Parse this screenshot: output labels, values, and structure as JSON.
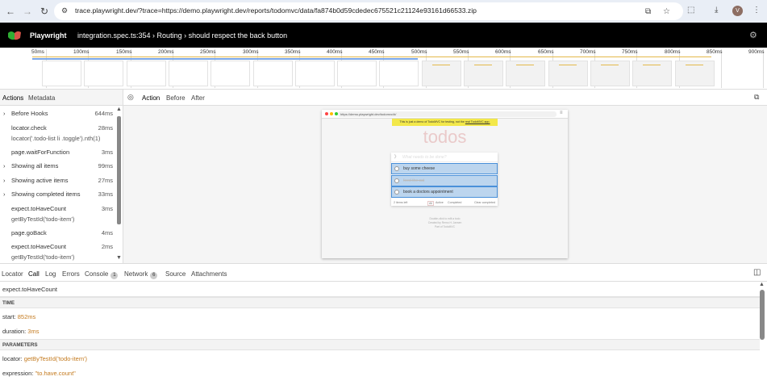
{
  "browser": {
    "url": "trace.playwright.dev/?trace=https://demo.playwright.dev/reports/todomvc/data/fa874b0d59cdedec675521c21124e93161d66533.zip",
    "profile_initial": "V"
  },
  "header": {
    "app_name": "Playwright",
    "test_path": "integration.spec.ts:354 › Routing › should respect the back button"
  },
  "timeline": {
    "ticks": [
      "50ms",
      "100ms",
      "150ms",
      "200ms",
      "250ms",
      "300ms",
      "350ms",
      "400ms",
      "450ms",
      "500ms",
      "550ms",
      "600ms",
      "650ms",
      "700ms",
      "750ms",
      "800ms",
      "850ms",
      "900ms"
    ]
  },
  "left_panel": {
    "tabs": [
      "Actions",
      "Metadata"
    ],
    "actions": [
      {
        "label": "Before Hooks",
        "duration": "644ms",
        "expandable": true
      },
      {
        "label": "locator.check",
        "sub": "locator('.todo-list li .toggle').nth(1)",
        "duration": "28ms"
      },
      {
        "label": "page.waitForFunction",
        "duration": "3ms"
      },
      {
        "label": "Showing all items",
        "duration": "99ms",
        "expandable": true
      },
      {
        "label": "Showing active items",
        "duration": "27ms",
        "expandable": true
      },
      {
        "label": "Showing completed items",
        "duration": "33ms",
        "expandable": true
      },
      {
        "label": "expect.toHaveCount",
        "sub": "getByTestId('todo-item')",
        "duration": "3ms"
      },
      {
        "label": "page.goBack",
        "duration": "4ms"
      },
      {
        "label": "expect.toHaveCount",
        "sub": "getByTestId('todo-item')",
        "duration": "2ms"
      }
    ]
  },
  "center_panel": {
    "tabs": [
      "Action",
      "Before",
      "After"
    ],
    "snapshot": {
      "url": "https://demo.playwright.dev/todomvc/#/",
      "banner_text": "This is just a demo of TodoMVC for testing, not the",
      "banner_link": "real TodoMVC app.",
      "title": "todos",
      "input_placeholder": "What needs to be done?",
      "items": [
        "buy some cheese",
        "feed the cat",
        "book a doctors appointment"
      ],
      "footer_count": "2 items left",
      "filters": [
        "All",
        "Active",
        "Completed"
      ],
      "clear_label": "Clear completed",
      "info_lines": [
        "Double-click to edit a todo",
        "Created by Remo H. Jansen",
        "Part of TodoMVC"
      ]
    }
  },
  "bottom_panel": {
    "tabs": [
      {
        "label": "Locator"
      },
      {
        "label": "Call"
      },
      {
        "label": "Log"
      },
      {
        "label": "Errors"
      },
      {
        "label": "Console",
        "count": "1"
      },
      {
        "label": "Network",
        "count": "6"
      },
      {
        "label": "Source"
      },
      {
        "label": "Attachments"
      }
    ],
    "call_title": "expect.toHaveCount",
    "time_header": "TIME",
    "start_label": "start:",
    "start_value": "852ms",
    "duration_label": "duration:",
    "duration_value": "3ms",
    "params_header": "PARAMETERS",
    "locator_label": "locator:",
    "locator_value": "getByTestId('todo-item')",
    "expression_label": "expression:",
    "expression_value": "\"to.have.count\""
  },
  "colors": {
    "accent": "#c47a1e",
    "header_bg": "#000000",
    "highlight": "#bcd5ee"
  }
}
